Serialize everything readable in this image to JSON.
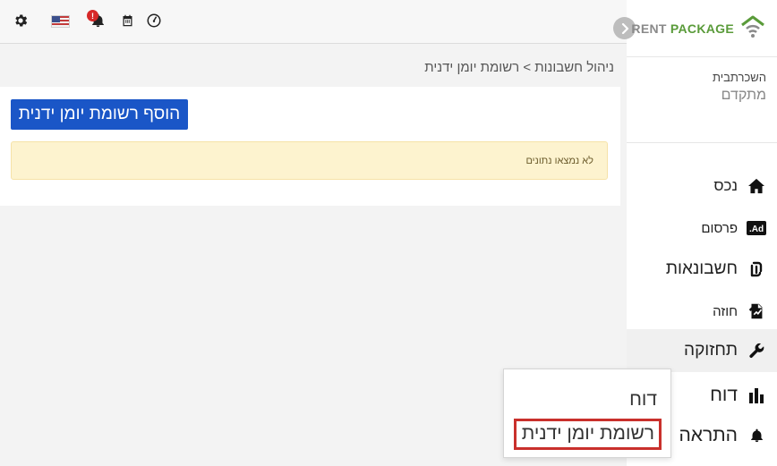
{
  "brand": {
    "logo_rent": "RENT",
    "logo_package": "PACKAGE",
    "icon_name": "house-wifi-icon"
  },
  "topbar": {
    "icons": [
      "gear-icon",
      "us-flag-icon",
      "bell-icon",
      "calendar-icon",
      "speedometer-icon"
    ],
    "notification_badge": "!"
  },
  "subscription": {
    "label": "השכרתבית",
    "plan": "מתקדם"
  },
  "sidebar": {
    "items": [
      {
        "label": "נכס",
        "icon": "home-icon"
      },
      {
        "label": "פרסום",
        "icon": "ad-icon"
      },
      {
        "label": "חשבונאות",
        "icon": "shekel-icon"
      },
      {
        "label": "חוזה",
        "icon": "contract-icon"
      },
      {
        "label": "תחזוקה",
        "icon": "wrench-icon"
      },
      {
        "label": "דוח",
        "icon": "bar-chart-icon"
      },
      {
        "label": "התראה",
        "icon": "bell-icon"
      }
    ]
  },
  "breadcrumb": "ניהול חשבונות > רשומת יומן ידנית",
  "main": {
    "add_button": "הוסף רשומת יומן ידנית",
    "empty_message": "לא נמצאו נתונים"
  },
  "dropdown": {
    "items": [
      "דוח",
      "רשומת יומן ידנית"
    ]
  },
  "colors": {
    "primary_button": "#1a56c7",
    "alert_bg": "#fdf3cf",
    "brand_green": "#5a9b3a",
    "selected_outline": "#c9302c",
    "badge_red": "#d62828"
  }
}
